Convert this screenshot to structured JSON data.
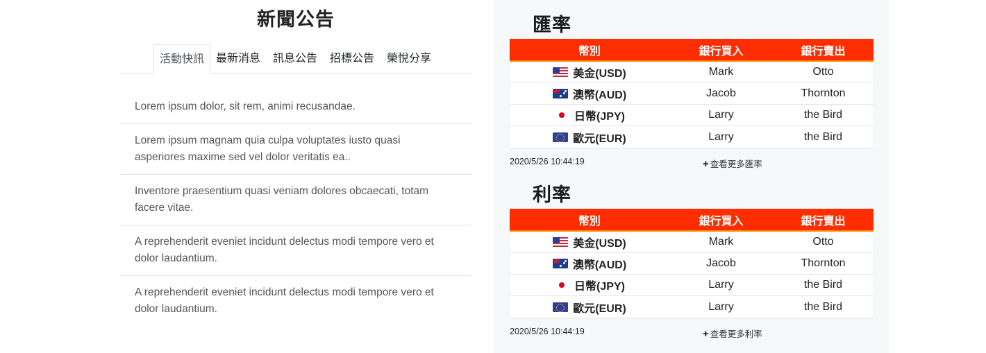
{
  "news": {
    "title": "新聞公告",
    "tabs": [
      {
        "label": "活動快訊",
        "active": true
      },
      {
        "label": "最新消息",
        "active": false
      },
      {
        "label": "訊息公告",
        "active": false
      },
      {
        "label": "招標公告",
        "active": false
      },
      {
        "label": "榮悅分享",
        "active": false
      }
    ],
    "items": [
      "Lorem ipsum dolor, sit rem, animi recusandae.",
      "Lorem ipsum magnam quia culpa voluptates iusto quasi asperiores maxime sed vel dolor veritatis ea..",
      "Inventore praesentium quasi veniam dolores obcaecati, totam facere vitae.",
      "A reprehenderit eveniet incidunt delectus modi tempore vero et dolor laudantium.",
      "A reprehenderit eveniet incidunt delectus modi tempore vero et dolor laudantium."
    ]
  },
  "exchange": {
    "title": "匯率",
    "headers": [
      "幣別",
      "銀行買入",
      "銀行賣出"
    ],
    "rows": [
      {
        "flag": "us-flag-icon",
        "currency": "美金(USD)",
        "buy": "Mark",
        "sell": "Otto"
      },
      {
        "flag": "au-flag-icon",
        "currency": "澳幣(AUD)",
        "buy": "Jacob",
        "sell": "Thornton"
      },
      {
        "flag": "jp-flag-icon",
        "currency": "日幣(JPY)",
        "buy": "Larry",
        "sell": "the Bird"
      },
      {
        "flag": "eu-flag-icon",
        "currency": "歐元(EUR)",
        "buy": "Larry",
        "sell": "the Bird"
      }
    ],
    "timestamp": "2020/5/26 10:44:19",
    "more_label": "查看更多匯率"
  },
  "interest": {
    "title": "利率",
    "headers": [
      "幣別",
      "銀行買入",
      "銀行賣出"
    ],
    "rows": [
      {
        "flag": "us-flag-icon",
        "currency": "美金(USD)",
        "buy": "Mark",
        "sell": "Otto"
      },
      {
        "flag": "au-flag-icon",
        "currency": "澳幣(AUD)",
        "buy": "Jacob",
        "sell": "Thornton"
      },
      {
        "flag": "jp-flag-icon",
        "currency": "日幣(JPY)",
        "buy": "Larry",
        "sell": "the Bird"
      },
      {
        "flag": "eu-flag-icon",
        "currency": "歐元(EUR)",
        "buy": "Larry",
        "sell": "the Bird"
      }
    ],
    "timestamp": "2020/5/26 10:44:19",
    "more_label": "查看更多利率"
  },
  "colors": {
    "table_header": "#ff2d00",
    "table_header_border": "#ff8a00",
    "panel_background": "#f7f8fa"
  },
  "icons": {
    "more": "plus-icon"
  }
}
